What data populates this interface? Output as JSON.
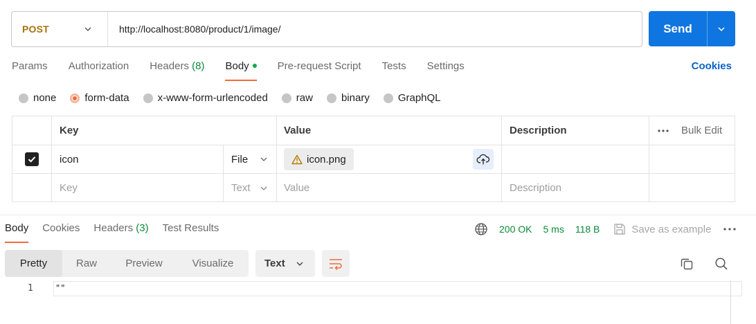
{
  "request": {
    "method": "POST",
    "url": "http://localhost:8080/product/1/image/",
    "send_label": "Send"
  },
  "request_tabs": {
    "params": "Params",
    "authorization": "Authorization",
    "headers": "Headers",
    "headers_count": "(8)",
    "body": "Body",
    "prescript": "Pre-request Script",
    "tests": "Tests",
    "settings": "Settings",
    "cookies": "Cookies"
  },
  "body_types": {
    "none": "none",
    "form_data": "form-data",
    "urlencoded": "x-www-form-urlencoded",
    "raw": "raw",
    "binary": "binary",
    "graphql": "GraphQL",
    "selected": "form-data"
  },
  "form_table": {
    "headers": {
      "key": "Key",
      "value": "Value",
      "description": "Description",
      "bulk_edit": "Bulk Edit"
    },
    "rows": [
      {
        "checked": true,
        "key": "icon",
        "type": "File",
        "value": "icon.png",
        "description": ""
      }
    ],
    "new_row": {
      "key": "Key",
      "type": "Text",
      "value": "Value",
      "description": "Description"
    }
  },
  "response_tabs": {
    "body": "Body",
    "cookies": "Cookies",
    "headers": "Headers",
    "headers_count": "(3)",
    "test_results": "Test Results"
  },
  "status": {
    "code": "200 OK",
    "time": "5 ms",
    "size": "118 B",
    "save_label": "Save as example"
  },
  "view": {
    "modes": [
      "Pretty",
      "Raw",
      "Preview",
      "Visualize"
    ],
    "active_mode": "Pretty",
    "format": "Text"
  },
  "response_body": {
    "line_number": "1",
    "content": "\"\""
  },
  "colors": {
    "method": "#a6720b",
    "send": "#0f75e0",
    "accent": "#f26b3a",
    "success": "#0a8a3a",
    "link": "#0b63c9"
  }
}
